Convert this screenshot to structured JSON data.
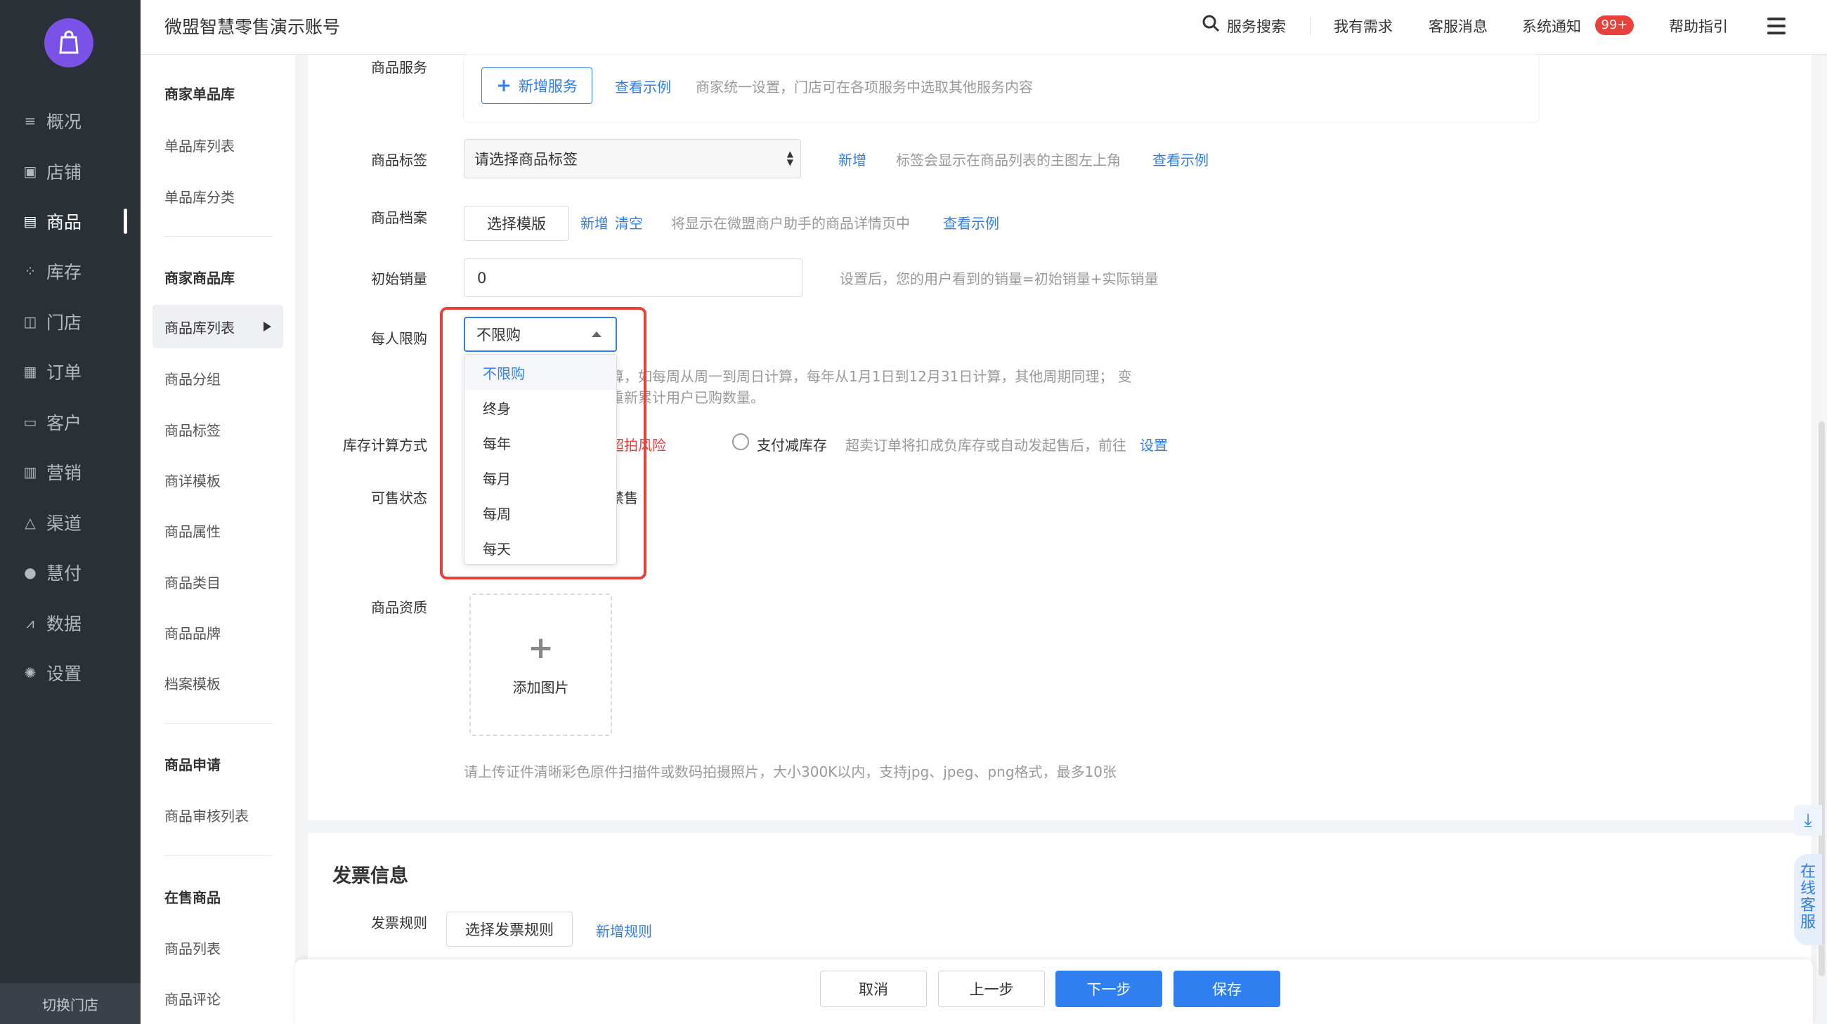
{
  "app": {
    "account_name": "微盟智慧零售演示账号"
  },
  "topbar": {
    "search_label": "服务搜索",
    "needs": "我有需求",
    "service_msg": "客服消息",
    "system_notice": "系统通知",
    "notice_badge": "99+",
    "help": "帮助指引"
  },
  "leftnav": {
    "items": [
      {
        "label": "概况",
        "icon": "list-icon"
      },
      {
        "label": "店铺",
        "icon": "store-icon"
      },
      {
        "label": "商品",
        "icon": "goods-icon",
        "active": true
      },
      {
        "label": "库存",
        "icon": "inventory-icon"
      },
      {
        "label": "门店",
        "icon": "shop-icon"
      },
      {
        "label": "订单",
        "icon": "order-icon"
      },
      {
        "label": "客户",
        "icon": "customer-icon"
      },
      {
        "label": "营销",
        "icon": "marketing-icon"
      },
      {
        "label": "渠道",
        "icon": "channel-icon"
      },
      {
        "label": "慧付",
        "icon": "pay-icon"
      },
      {
        "label": "数据",
        "icon": "data-icon"
      },
      {
        "label": "设置",
        "icon": "settings-icon"
      }
    ],
    "switch_store": "切换门店"
  },
  "subnav": {
    "group1": {
      "title": "商家单品库",
      "items": [
        "单品库列表",
        "单品库分类"
      ]
    },
    "group2": {
      "title": "商家商品库",
      "items": [
        "商品库列表",
        "商品分组",
        "商品标签",
        "商详模板",
        "商品属性",
        "商品类目",
        "商品品牌",
        "档案模板"
      ]
    },
    "group3": {
      "title": "商品申请",
      "items": [
        "商品审核列表"
      ]
    },
    "group4": {
      "title": "在售商品",
      "items": [
        "商品列表",
        "商品评论"
      ]
    }
  },
  "form": {
    "service": {
      "label": "商品服务",
      "add_btn": "新增服务",
      "example": "查看示例",
      "hint": "商家统一设置，门店可在各项服务中选取其他服务内容"
    },
    "tag": {
      "label": "商品标签",
      "placeholder": "请选择商品标签",
      "add": "新增",
      "hint": "标签会显示在商品列表的主图左上角",
      "example": "查看示例"
    },
    "archive": {
      "label": "商品档案",
      "select_btn": "选择模版",
      "add": "新增",
      "clear": "清空",
      "hint": "将显示在微盟商户助手的商品详情页中",
      "example": "查看示例"
    },
    "initial_sales": {
      "label": "初始销量",
      "value": "0",
      "hint": "设置后，您的用户看到的销量=初始销量+实际销量"
    },
    "limit": {
      "label": "每人限购",
      "selected": "不限购",
      "options": [
        "不限购",
        "终身",
        "每年",
        "每月",
        "每周",
        "每天"
      ],
      "hint_line1": "算，如每周从周一到周日计算，每年从1月1日到12月31日计算，其他周期同理； 变",
      "hint_line2": "重新累计用户已购数量。"
    },
    "stock_calc": {
      "label": "库存计算方式",
      "risk_text": "超拍风险",
      "pay_reduce": "支付减库存",
      "hint": "超卖订单将扣成负库存或自动发起售后，前往",
      "setting_link": "设置"
    },
    "sale_status": {
      "label": "可售状态",
      "partial_text": "禁售"
    },
    "qualification": {
      "label": "商品资质",
      "add_image": "添加图片",
      "hint": "请上传证件清晰彩色原件扫描件或数码拍摄照片，大小300K以内，支持jpg、jpeg、png格式，最多10张"
    }
  },
  "invoice": {
    "title": "发票信息",
    "rule_label": "发票规则",
    "select_btn": "选择发票规则",
    "add_link": "新增规则"
  },
  "actions": {
    "cancel": "取消",
    "prev": "上一步",
    "next": "下一步",
    "save": "保存"
  },
  "float": {
    "online_service": "在线客服"
  },
  "colors": {
    "primary": "#2f7ff1",
    "danger": "#e8413b",
    "nav_bg": "#293036",
    "logo": "#7a52e8"
  }
}
